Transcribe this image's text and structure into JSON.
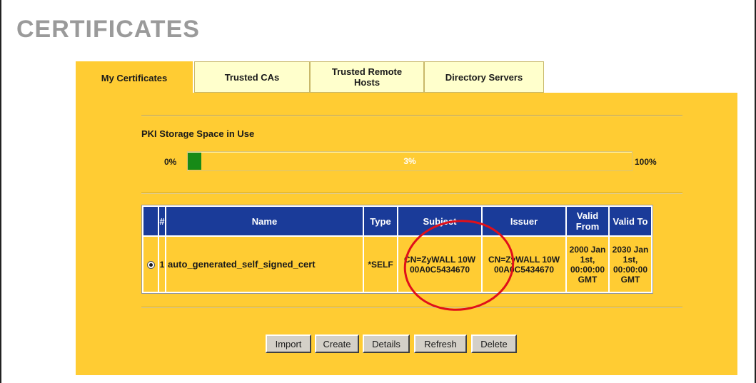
{
  "page_title": "CERTIFICATES",
  "tabs": [
    {
      "label": "My Certificates",
      "active": true
    },
    {
      "label": "Trusted CAs",
      "active": false
    },
    {
      "label": "Trusted Remote Hosts",
      "active": false
    },
    {
      "label": "Directory Servers",
      "active": false
    }
  ],
  "pki": {
    "label": "PKI Storage Space in Use",
    "min_label": "0%",
    "max_label": "100%",
    "usage_text": "3%",
    "usage_fraction": 0.03
  },
  "table": {
    "headers": {
      "select": "",
      "index": "#",
      "name": "Name",
      "type": "Type",
      "subject": "Subject",
      "issuer": "Issuer",
      "valid_from": "Valid From",
      "valid_to": "Valid To"
    },
    "rows": [
      {
        "selected": true,
        "index": "1",
        "name": "auto_generated_self_signed_cert",
        "type": "*SELF",
        "subject": "CN=ZyWALL 10W 00A0C5434670",
        "issuer": "CN=ZyWALL 10W 00A0C5434670",
        "valid_from": "2000 Jan 1st, 00:00:00 GMT",
        "valid_to": "2030 Jan 1st, 00:00:00 GMT"
      }
    ]
  },
  "buttons": {
    "import": "Import",
    "create": "Create",
    "details": "Details",
    "refresh": "Refresh",
    "delete": "Delete"
  },
  "colors": {
    "panel": "#ffcc33",
    "tab_inactive": "#ffffcc",
    "header": "#1a3b99",
    "progress_fill": "#178a17",
    "annotation": "#e0101a"
  }
}
